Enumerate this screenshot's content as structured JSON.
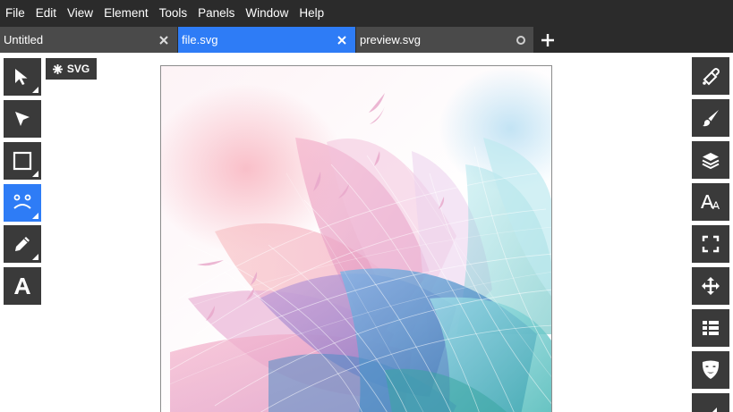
{
  "menu": [
    "File",
    "Edit",
    "View",
    "Element",
    "Tools",
    "Panels",
    "Window",
    "Help"
  ],
  "tabs": [
    {
      "label": "Untitled",
      "active": false,
      "control": "close"
    },
    {
      "label": "file.svg",
      "active": true,
      "control": "close"
    },
    {
      "label": "preview.svg",
      "active": false,
      "control": "unsaved-dot"
    }
  ],
  "badge": {
    "icon": "asterisk-icon",
    "label": "SVG"
  },
  "left_tools": [
    {
      "name": "select-tool",
      "icon": "arrow-cursor-icon",
      "active": false,
      "has_submenu": true
    },
    {
      "name": "node-tool",
      "icon": "node-arrow-icon",
      "active": false,
      "has_submenu": false
    },
    {
      "name": "rectangle-tool",
      "icon": "square-icon",
      "active": false,
      "has_submenu": true
    },
    {
      "name": "path-tool",
      "icon": "bezier-face-icon",
      "active": true,
      "has_submenu": true
    },
    {
      "name": "pencil-tool",
      "icon": "pencil-icon",
      "active": false,
      "has_submenu": true
    },
    {
      "name": "text-tool",
      "icon": "letter-a-icon",
      "active": false,
      "has_submenu": false
    }
  ],
  "right_tools": [
    {
      "name": "fill-panel",
      "icon": "paint-bucket-icon"
    },
    {
      "name": "stroke-panel",
      "icon": "brush-icon"
    },
    {
      "name": "layers-panel",
      "icon": "layers-icon"
    },
    {
      "name": "font-panel",
      "icon": "font-icon"
    },
    {
      "name": "transform-panel",
      "icon": "expand-icon"
    },
    {
      "name": "arrange-panel",
      "icon": "move-icon"
    },
    {
      "name": "properties-panel",
      "icon": "list-icon"
    },
    {
      "name": "mask-panel",
      "icon": "mask-icon"
    },
    {
      "name": "export-panel",
      "icon": "corner-icon"
    }
  ],
  "colors": {
    "chrome": "#2b2b2b",
    "tab": "#4a4a4a",
    "accent": "#2e7cf6",
    "tool": "#3a3a3a"
  }
}
